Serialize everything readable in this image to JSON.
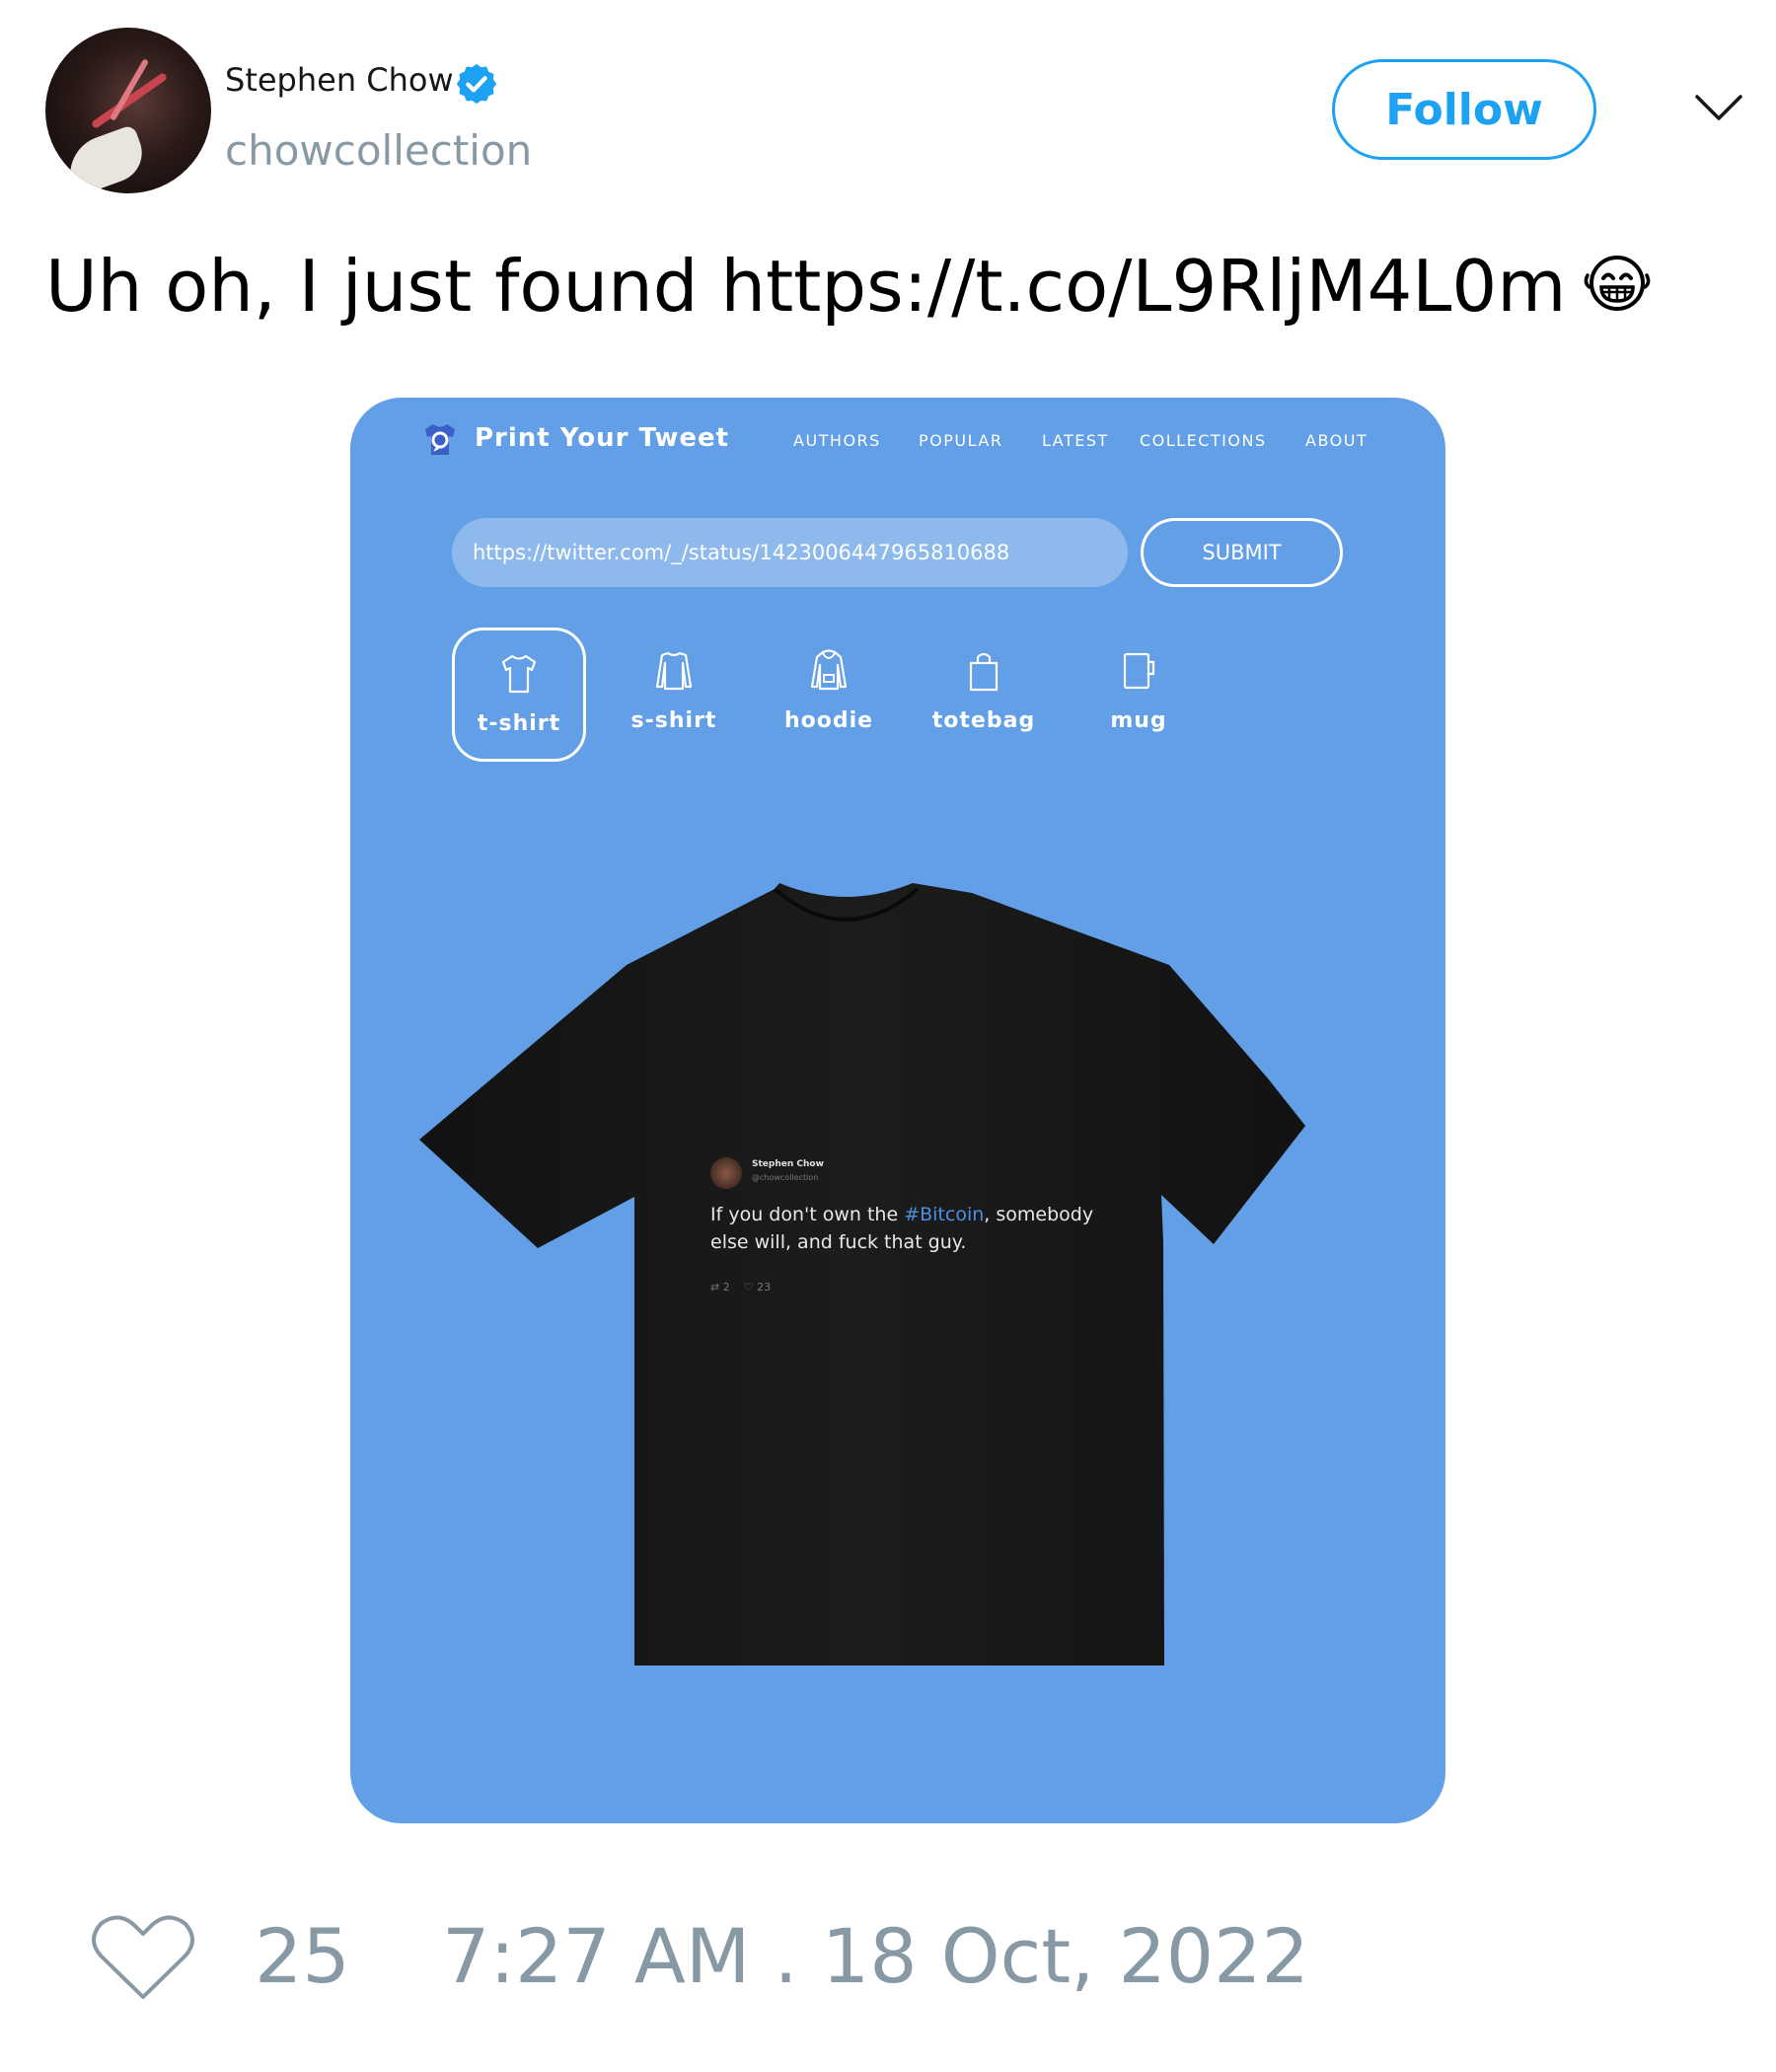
{
  "author": {
    "display_name": "Stephen Chow",
    "handle": "chowcollection",
    "verified_icon": "verified-badge-icon",
    "follow_label": "Follow"
  },
  "tweet": {
    "text": "Uh oh, I just found https://t.co/L9RljM4L0m",
    "emoji": "laughing-face-icon"
  },
  "media": {
    "site_name": "Print Your Tweet",
    "nav": [
      "AUTHORS",
      "POPULAR",
      "LATEST",
      "COLLECTIONS",
      "ABOUT"
    ],
    "url_value": "https://twitter.com/_/status/1423006447965810688",
    "submit_label": "SUBMIT",
    "products": [
      {
        "label": "t-shirt",
        "selected": true,
        "icon": "tshirt-icon"
      },
      {
        "label": "s-shirt",
        "selected": false,
        "icon": "sweatshirt-icon"
      },
      {
        "label": "hoodie",
        "selected": false,
        "icon": "hoodie-icon"
      },
      {
        "label": "totebag",
        "selected": false,
        "icon": "totebag-icon"
      },
      {
        "label": "mug",
        "selected": false,
        "icon": "mug-icon"
      }
    ],
    "printed_tweet": {
      "name": "Stephen Chow",
      "handle": "@chowcollection",
      "text_before": "If you don't own the ",
      "hashtag": "#Bitcoin",
      "text_after": ", somebody else will, and fuck that guy.",
      "retweets": "2",
      "likes": "23"
    },
    "background_color": "#629fe6",
    "shirt_color": "#1a1a1a"
  },
  "footer": {
    "like_count": "25",
    "timestamp": "7:27 AM . 18 Oct, 2022"
  },
  "colors": {
    "accent": "#1da1f2",
    "muted": "#8899a6"
  }
}
